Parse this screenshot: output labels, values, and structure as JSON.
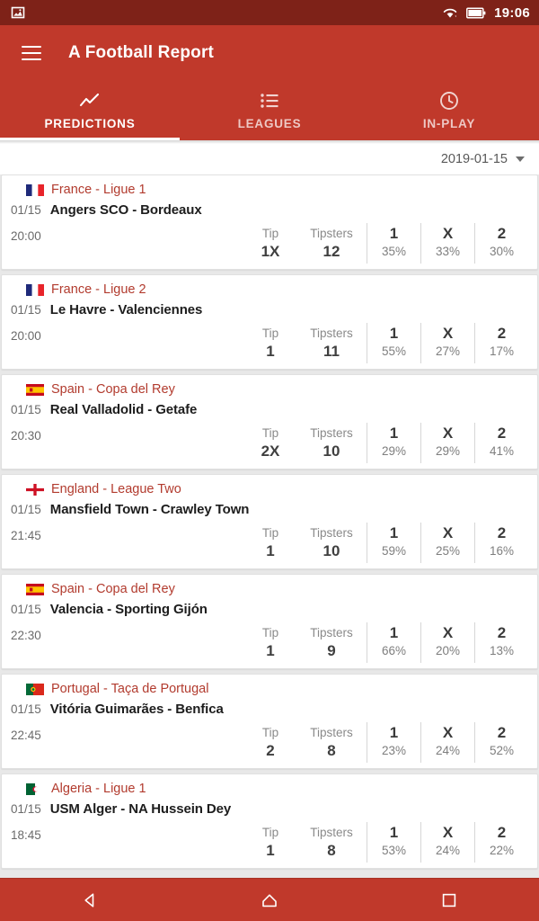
{
  "status_bar": {
    "notification_icon": "image-icon",
    "wifi_icon": "wifi-icon",
    "battery_icon": "battery-icon",
    "time": "19:06"
  },
  "app_bar": {
    "menu_icon": "hamburger-menu-icon",
    "title": "A Football Report"
  },
  "tabs": {
    "active_index": 0,
    "items": [
      {
        "label": "PREDICTIONS",
        "icon": "trending-up-icon"
      },
      {
        "label": "LEAGUES",
        "icon": "list-icon"
      },
      {
        "label": "IN-PLAY",
        "icon": "clock-icon"
      }
    ]
  },
  "date_selector": {
    "value": "2019-01-15",
    "caret_icon": "chevron-down-icon"
  },
  "column_headers": {
    "tip": "Tip",
    "tipsters": "Tipsters",
    "home": "1",
    "draw": "X",
    "away": "2"
  },
  "matches": [
    {
      "flag": "flag-france",
      "league": "France - Ligue 1",
      "date": "01/15",
      "teams": "Angers SCO - Bordeaux",
      "time": "20:00",
      "tip": "1X",
      "tipsters": "12",
      "home_pct": "35%",
      "draw_pct": "33%",
      "away_pct": "30%"
    },
    {
      "flag": "flag-france",
      "league": "France - Ligue 2",
      "date": "01/15",
      "teams": "Le Havre - Valenciennes",
      "time": "20:00",
      "tip": "1",
      "tipsters": "11",
      "home_pct": "55%",
      "draw_pct": "27%",
      "away_pct": "17%"
    },
    {
      "flag": "flag-spain",
      "league": "Spain - Copa del Rey",
      "date": "01/15",
      "teams": "Real Valladolid - Getafe",
      "time": "20:30",
      "tip": "2X",
      "tipsters": "10",
      "home_pct": "29%",
      "draw_pct": "29%",
      "away_pct": "41%"
    },
    {
      "flag": "flag-england",
      "league": "England - League Two",
      "date": "01/15",
      "teams": "Mansfield Town - Crawley Town",
      "time": "21:45",
      "tip": "1",
      "tipsters": "10",
      "home_pct": "59%",
      "draw_pct": "25%",
      "away_pct": "16%"
    },
    {
      "flag": "flag-spain",
      "league": "Spain - Copa del Rey",
      "date": "01/15",
      "teams": "Valencia - Sporting Gijón",
      "time": "22:30",
      "tip": "1",
      "tipsters": "9",
      "home_pct": "66%",
      "draw_pct": "20%",
      "away_pct": "13%"
    },
    {
      "flag": "flag-portugal",
      "league": "Portugal - Taça de Portugal",
      "date": "01/15",
      "teams": "Vitória Guimarães - Benfica",
      "time": "22:45",
      "tip": "2",
      "tipsters": "8",
      "home_pct": "23%",
      "draw_pct": "24%",
      "away_pct": "52%"
    },
    {
      "flag": "flag-algeria",
      "league": "Algeria - Ligue 1",
      "date": "01/15",
      "teams": "USM Alger - NA Hussein Dey",
      "time": "18:45",
      "tip": "1",
      "tipsters": "8",
      "home_pct": "53%",
      "draw_pct": "24%",
      "away_pct": "22%"
    }
  ],
  "nav_bar": {
    "back_icon": "back-triangle-icon",
    "home_icon": "home-icon",
    "recents_icon": "recents-square-icon"
  },
  "colors": {
    "primary": "#c0392b",
    "status_bar": "#7e2218",
    "league_text": "#b23b2e",
    "accent_white": "#ffffff"
  }
}
